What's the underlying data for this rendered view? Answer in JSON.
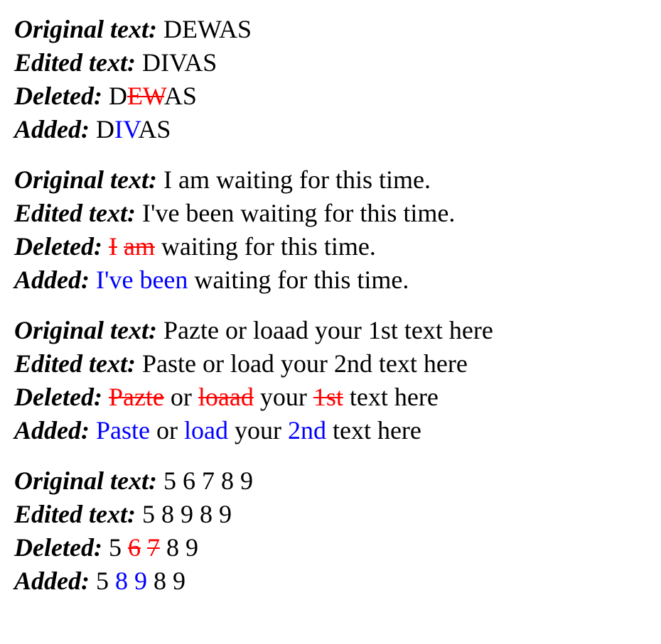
{
  "labels": {
    "original": "Original text:",
    "edited": "Edited text:",
    "deleted": "Deleted:",
    "added": "Added:"
  },
  "colors": {
    "deleted": "#ff0000",
    "added": "#0000ff",
    "text": "#000000"
  },
  "examples": [
    {
      "original": "DEWAS",
      "edited": "DIVAS",
      "deleted": [
        {
          "text": "D",
          "type": "plain"
        },
        {
          "text": "EW",
          "type": "del"
        },
        {
          "text": "AS",
          "type": "plain"
        }
      ],
      "added": [
        {
          "text": "D",
          "type": "plain"
        },
        {
          "text": "IV",
          "type": "add"
        },
        {
          "text": "AS",
          "type": "plain"
        }
      ]
    },
    {
      "original": "I am waiting for this time.",
      "edited": "I've been waiting for this time.",
      "deleted": [
        {
          "text": "I",
          "type": "del"
        },
        {
          "text": " ",
          "type": "plain"
        },
        {
          "text": "am",
          "type": "del"
        },
        {
          "text": " waiting for this time.",
          "type": "plain"
        }
      ],
      "added": [
        {
          "text": "I've been",
          "type": "add"
        },
        {
          "text": " waiting for this time.",
          "type": "plain"
        }
      ]
    },
    {
      "original": "Pazte or loaad your 1st text here",
      "edited": "Paste or load your 2nd text here",
      "deleted": [
        {
          "text": "Pazte",
          "type": "del"
        },
        {
          "text": " or ",
          "type": "plain"
        },
        {
          "text": "loaad",
          "type": "del"
        },
        {
          "text": " your ",
          "type": "plain"
        },
        {
          "text": "1st",
          "type": "del"
        },
        {
          "text": " text here",
          "type": "plain"
        }
      ],
      "added": [
        {
          "text": "Paste",
          "type": "add"
        },
        {
          "text": " or ",
          "type": "plain"
        },
        {
          "text": "load",
          "type": "add"
        },
        {
          "text": " your ",
          "type": "plain"
        },
        {
          "text": "2nd",
          "type": "add"
        },
        {
          "text": " text here",
          "type": "plain"
        }
      ]
    },
    {
      "original": "5 6 7 8 9",
      "edited": "5 8 9 8 9",
      "deleted": [
        {
          "text": "5 ",
          "type": "plain"
        },
        {
          "text": "6",
          "type": "del"
        },
        {
          "text": " ",
          "type": "plain"
        },
        {
          "text": "7",
          "type": "del"
        },
        {
          "text": " 8 9",
          "type": "plain"
        }
      ],
      "added": [
        {
          "text": "5 ",
          "type": "plain"
        },
        {
          "text": "8",
          "type": "add"
        },
        {
          "text": " ",
          "type": "plain"
        },
        {
          "text": "9",
          "type": "add"
        },
        {
          "text": " 8 9",
          "type": "plain"
        }
      ]
    }
  ]
}
